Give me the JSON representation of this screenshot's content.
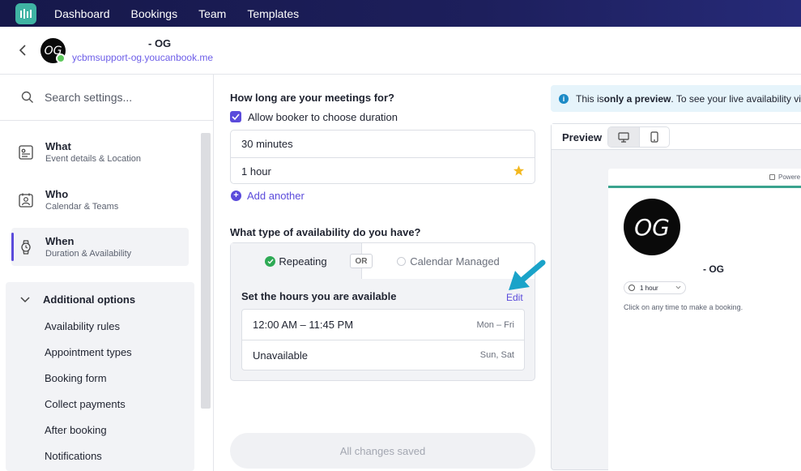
{
  "nav": {
    "items": [
      "Dashboard",
      "Bookings",
      "Team",
      "Templates"
    ]
  },
  "header": {
    "avatar_text": "OG",
    "name": "- OG",
    "url": "ycbmsupport-og.youcanbook.me"
  },
  "sidebar": {
    "search_placeholder": "Search settings...",
    "items": [
      {
        "title": "What",
        "subtitle": "Event details & Location",
        "icon": "document-icon"
      },
      {
        "title": "Who",
        "subtitle": "Calendar & Teams",
        "icon": "contact-card-icon"
      },
      {
        "title": "When",
        "subtitle": "Duration & Availability",
        "icon": "watch-icon"
      }
    ],
    "additional": {
      "title": "Additional options",
      "items": [
        "Availability rules",
        "Appointment types",
        "Booking form",
        "Collect payments",
        "After booking",
        "Notifications"
      ]
    }
  },
  "main": {
    "duration_title": "How long are your meetings for?",
    "allow_choose_label": "Allow booker to choose duration",
    "allow_choose_checked": true,
    "durations": [
      "30 minutes",
      "1 hour"
    ],
    "add_another_label": "Add another",
    "availability_title": "What type of availability do you have?",
    "tab_repeating": "Repeating",
    "tab_or": "OR",
    "tab_calendar": "Calendar Managed",
    "hours_title": "Set the hours you are available",
    "edit_label": "Edit",
    "hours": [
      {
        "time": "12:00 AM – 11:45 PM",
        "days": "Mon – Fri"
      },
      {
        "time": "Unavailable",
        "days": "Sun, Sat"
      }
    ],
    "save_label": "All changes saved"
  },
  "preview": {
    "notice_pre": "This is ",
    "notice_bold": "only a preview",
    "notice_post": ". To see your live availability vis",
    "label": "Preview",
    "powered": "Powere",
    "avatar_text": "OG",
    "name": "- OG",
    "duration": "1 hour",
    "hint": "Click on any time to make a booking."
  },
  "colors": {
    "accent": "#5b4bdb",
    "nav_bg": "#1d1f5c",
    "success": "#2eaa55",
    "info": "#1c8ac6",
    "arrow": "#1aa3c9"
  }
}
